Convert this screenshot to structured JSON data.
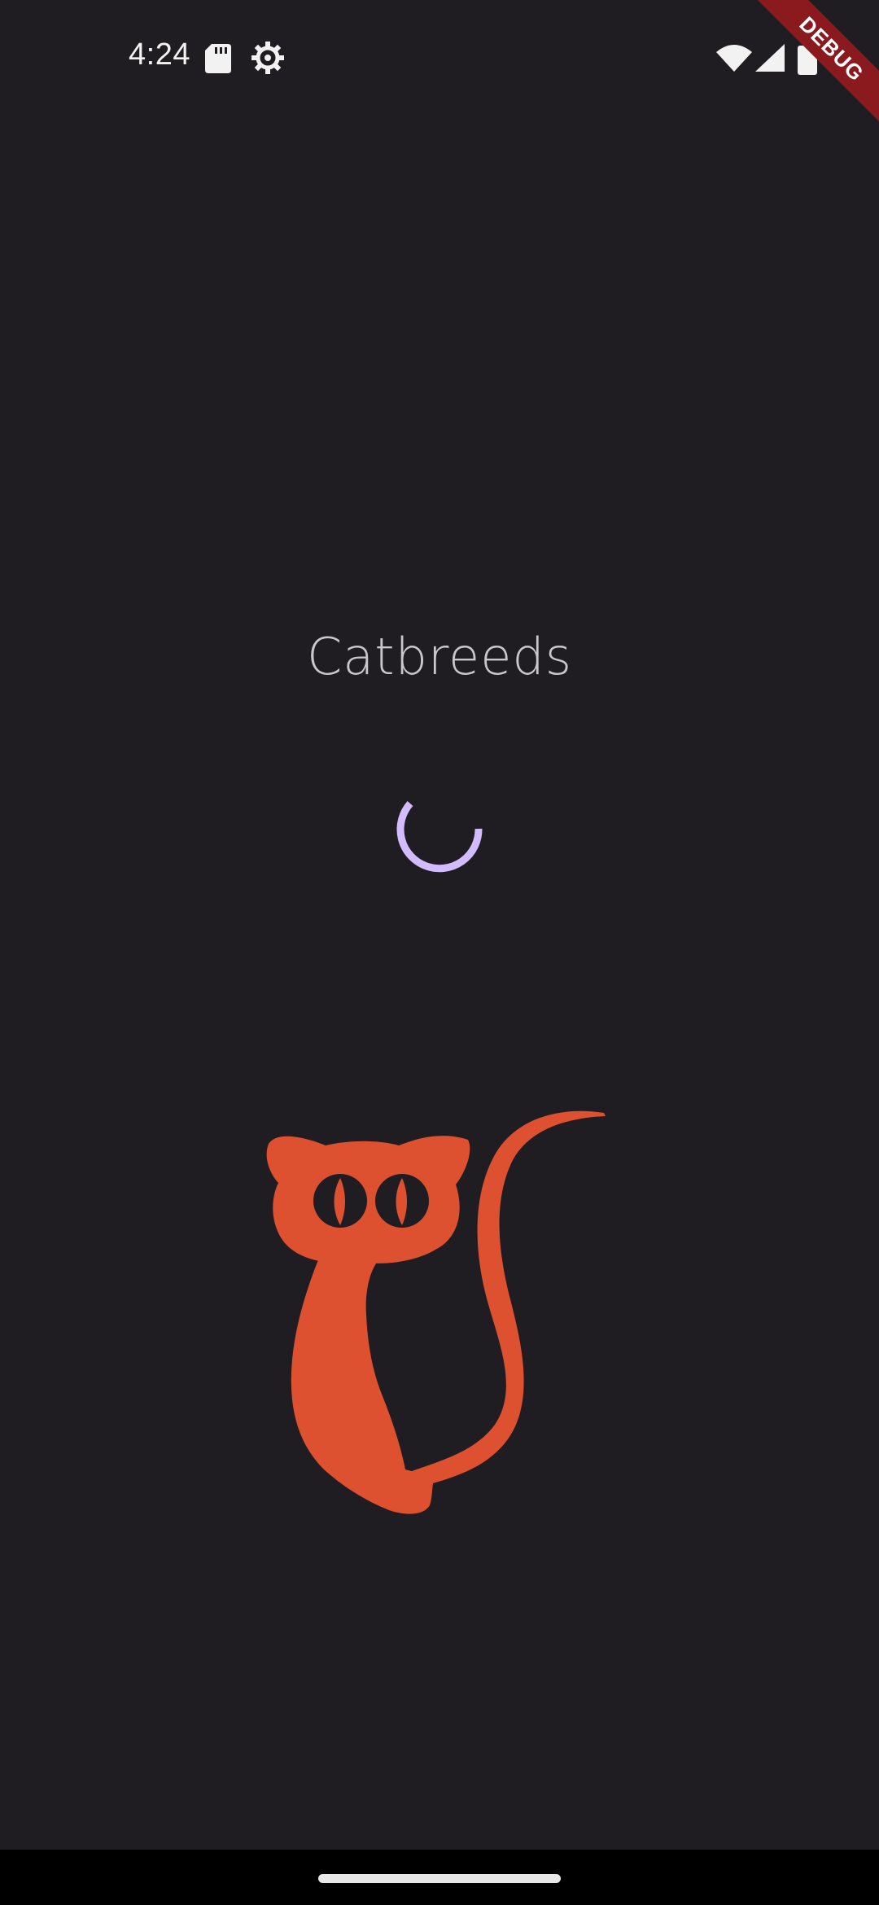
{
  "status_bar": {
    "time": "4:24",
    "icons": [
      "sd-card-icon",
      "gear-icon",
      "wifi-icon",
      "signal-icon",
      "battery-icon"
    ]
  },
  "debug_banner": {
    "label": "DEBUG",
    "color": "#8b1a1f"
  },
  "splash": {
    "title": "Catbreeds",
    "spinner_color": "#d3bcfd",
    "logo_color": "#dd5130"
  },
  "colors": {
    "background": "#1f1d21",
    "title_text": "#c9c6cc",
    "nav_bar": "#000000"
  }
}
